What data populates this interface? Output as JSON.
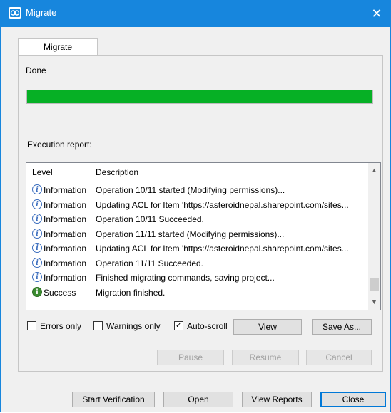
{
  "window": {
    "title": "Migrate",
    "close_glyph": "✕",
    "icon": "migrate-app-icon",
    "accent": "#1786dd"
  },
  "tab": {
    "label": "Migrate"
  },
  "status": {
    "text": "Done",
    "progress_percent": 100,
    "progress_color": "#06b025"
  },
  "report": {
    "label": "Execution report:",
    "columns": {
      "level": "Level",
      "description": "Description"
    },
    "rows": [
      {
        "icon": "info",
        "level": "Information",
        "description": "Operation 10/11 started (Modifying permissions)..."
      },
      {
        "icon": "info",
        "level": "Information",
        "description": "Updating ACL for Item 'https://asteroidnepal.sharepoint.com/sites..."
      },
      {
        "icon": "info",
        "level": "Information",
        "description": "Operation 10/11 Succeeded."
      },
      {
        "icon": "info",
        "level": "Information",
        "description": "Operation 11/11 started (Modifying permissions)..."
      },
      {
        "icon": "info",
        "level": "Information",
        "description": "Updating ACL for Item 'https://asteroidnepal.sharepoint.com/sites..."
      },
      {
        "icon": "info",
        "level": "Information",
        "description": "Operation 11/11 Succeeded."
      },
      {
        "icon": "info",
        "level": "Information",
        "description": "Finished migrating commands, saving project..."
      },
      {
        "icon": "success",
        "level": "Success",
        "description": "Migration finished."
      }
    ]
  },
  "filters": {
    "errors_only": {
      "label": "Errors only",
      "checked": false
    },
    "warnings_only": {
      "label": "Warnings only",
      "checked": false
    },
    "auto_scroll": {
      "label": "Auto-scroll",
      "checked": true
    }
  },
  "buttons": {
    "view": "View",
    "save_as": "Save As...",
    "pause": "Pause",
    "resume": "Resume",
    "cancel": "Cancel",
    "start_verification": "Start Verification",
    "open": "Open",
    "view_reports": "View Reports",
    "close": "Close"
  }
}
